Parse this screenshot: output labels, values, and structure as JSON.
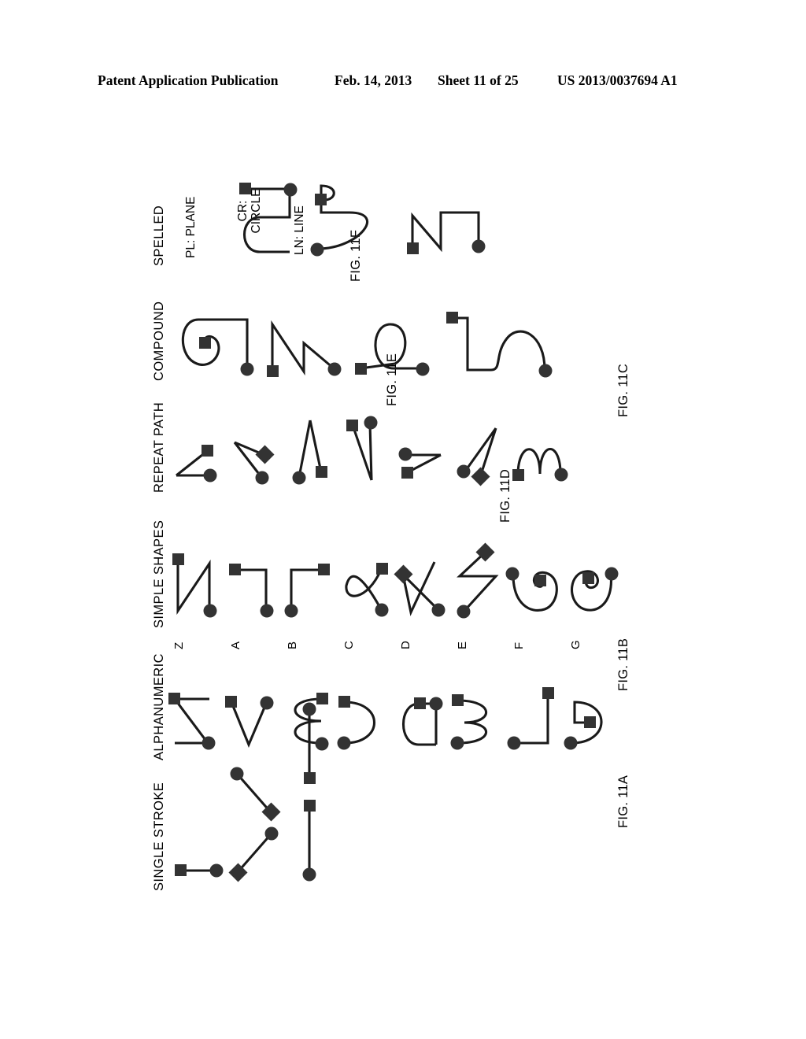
{
  "header": {
    "publication": "Patent Application Publication",
    "date": "Feb. 14, 2013",
    "sheet": "Sheet 11 of 25",
    "number": "US 2013/0037694 A1"
  },
  "figure": {
    "plate_label": "FIG. 11",
    "columns": [
      {
        "id": "single-stroke",
        "label": "SINGLE STROKE",
        "caption": "FIG. 11A"
      },
      {
        "id": "alphanumeric",
        "label": "ALPHANUMERIC",
        "caption": "FIG. 11B"
      },
      {
        "id": "simple-shapes",
        "label": "SIMPLE SHAPES",
        "caption": "FIG. 11C"
      },
      {
        "id": "repeat-path",
        "label": "REPEAT PATH",
        "caption": "FIG. 11D"
      },
      {
        "id": "compound",
        "label": "COMPOUND",
        "caption": "FIG. 11E"
      },
      {
        "id": "spelled",
        "label": "SPELLED",
        "caption": "FIG. 11F"
      }
    ],
    "row_labels": [
      "Z",
      "A",
      "B",
      "C",
      "D",
      "E",
      "F",
      "G"
    ],
    "spelled_annotations": [
      {
        "id": "plane",
        "abbrev": "PL:",
        "word": "PLANE"
      },
      {
        "id": "circle",
        "abbrev": "CR:",
        "word": "CIRCLE"
      },
      {
        "id": "line",
        "abbrev": "LN:",
        "word": "LINE"
      }
    ],
    "marker_legend": {
      "start": "circle-marker",
      "end": "square-marker",
      "midpoint": "diamond-marker"
    },
    "colors": {
      "ink": "#1a1a1a",
      "marker": "#333333",
      "paper": "#ffffff"
    },
    "stroke_counts": {
      "single-stroke": 4,
      "alphanumeric": 8,
      "simple-shapes": 8,
      "repeat-path": 7,
      "compound": 4,
      "spelled": 3
    }
  }
}
